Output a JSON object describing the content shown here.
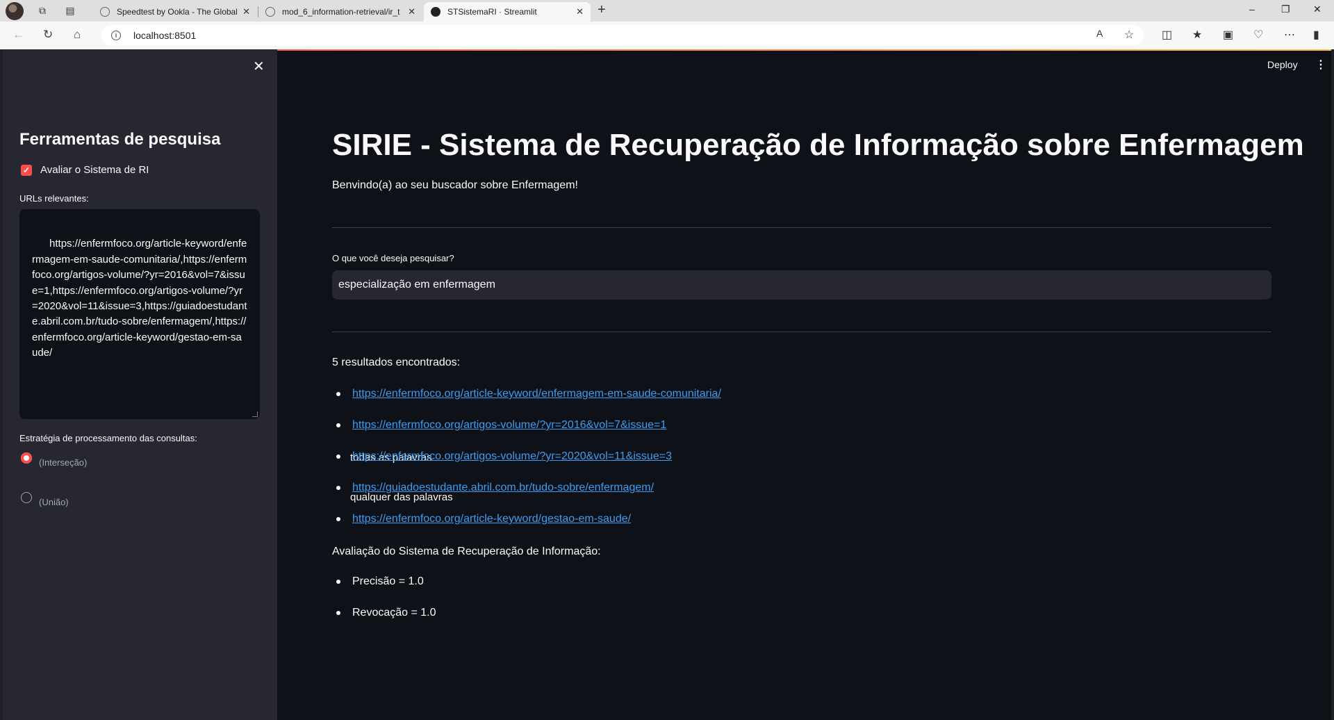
{
  "browser": {
    "tabs": [
      {
        "title": "Speedtest by Ookla - The Global",
        "icon": "speedtest-icon"
      },
      {
        "title": "mod_6_information-retrieval/ir_t",
        "icon": "github-icon"
      },
      {
        "title": "STSistemaRI · Streamlit",
        "icon": "streamlit-icon"
      }
    ],
    "address": "localhost:8501"
  },
  "sidebar": {
    "title": "Ferramentas de pesquisa",
    "evaluate_label": "Avaliar o Sistema de RI",
    "evaluate_checked": true,
    "urls_label": "URLs relevantes:",
    "urls_value": "https://enfermfoco.org/article-keyword/enfermagem-em-saude-comunitaria/,https://enfermfoco.org/artigos-volume/?yr=2016&vol=7&issue=1,https://enfermfoco.org/artigos-volume/?yr=2020&vol=11&issue=3,https://guiadoestudante.abril.com.br/tudo-sobre/enfermagem/,https://enfermfoco.org/article-keyword/gestao-em-saude/",
    "strategy_label": "Estratégia de processamento das consultas:",
    "options": [
      {
        "label": "todas as palavras",
        "caption": "(Interseção)",
        "selected": true
      },
      {
        "label": "qualquer das palavras",
        "caption": "(União)",
        "selected": false
      }
    ]
  },
  "header": {
    "deploy_label": "Deploy"
  },
  "main": {
    "title": "SIRIE - Sistema de Recuperação de Informação sobre Enfermagem",
    "welcome": "Benvindo(a) ao seu buscador sobre Enfermagem!",
    "query_label": "O que você deseja pesquisar?",
    "query_value": "especialização em enfermagem",
    "results_count": "5 resultados encontrados:",
    "results": [
      "https://enfermfoco.org/article-keyword/enfermagem-em-saude-comunitaria/",
      "https://enfermfoco.org/artigos-volume/?yr=2016&vol=7&issue=1",
      "https://enfermfoco.org/artigos-volume/?yr=2020&vol=11&issue=3",
      "https://guiadoestudante.abril.com.br/tudo-sobre/enfermagem/",
      "https://enfermfoco.org/article-keyword/gestao-em-saude/"
    ],
    "eval_title": "Avaliação do Sistema de Recuperação de Informação:",
    "metrics": [
      "Precisão = 1.0",
      "Revocação = 1.0"
    ]
  },
  "colors": {
    "accent": "#ff4b4b",
    "link": "#3d9df3",
    "background": "#0e1117",
    "sidebar": "#262730"
  }
}
